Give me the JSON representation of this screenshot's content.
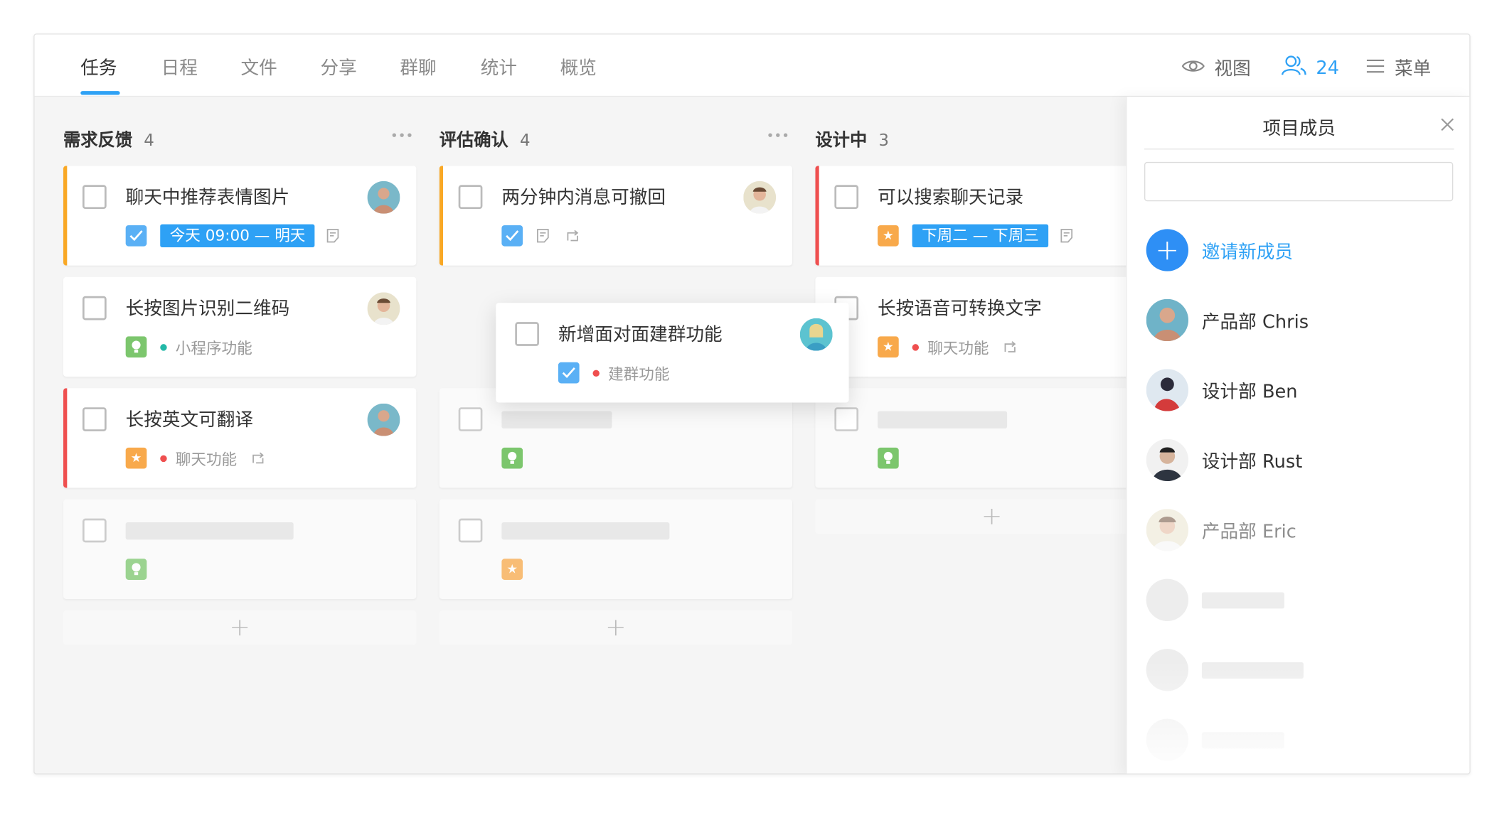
{
  "tabs": [
    {
      "label": "任务",
      "active": true
    },
    {
      "label": "日程"
    },
    {
      "label": "文件"
    },
    {
      "label": "分享"
    },
    {
      "label": "群聊"
    },
    {
      "label": "统计"
    },
    {
      "label": "概览"
    }
  ],
  "toolbar": {
    "view_label": "视图",
    "members_count": "24",
    "menu_label": "菜单"
  },
  "columns": [
    {
      "title": "需求反馈",
      "count": "4",
      "cards": [
        {
          "title": "聊天中推荐表情图片",
          "date": "今天 09:00 — 明天"
        },
        {
          "title": "长按图片识别二维码",
          "tag": "小程序功能"
        },
        {
          "title": "长按英文可翻译",
          "tag": "聊天功能"
        }
      ]
    },
    {
      "title": "评估确认",
      "count": "4",
      "cards": [
        {
          "title": "两分钟内消息可撤回"
        },
        {
          "title": "新增面对面建群功能",
          "tag": "建群功能"
        }
      ]
    },
    {
      "title": "设计中",
      "count": "3",
      "cards": [
        {
          "title": "可以搜索聊天记录",
          "date": "下周二 — 下周三"
        },
        {
          "title": "长按语音可转换文字",
          "tag": "聊天功能"
        }
      ]
    }
  ],
  "panel": {
    "title": "项目成员",
    "search_value": "",
    "invite_label": "邀请新成员",
    "members": [
      {
        "name": "产品部 Chris"
      },
      {
        "name": "设计部 Ben"
      },
      {
        "name": "设计部 Rust"
      },
      {
        "name": "产品部 Eric"
      }
    ]
  },
  "colors": {
    "accent": "#2ea1f5",
    "priority_orange": "#f9a825",
    "priority_red": "#ef4f4f",
    "badge_green": "#7cc66d",
    "badge_orange": "#f8a94b"
  }
}
